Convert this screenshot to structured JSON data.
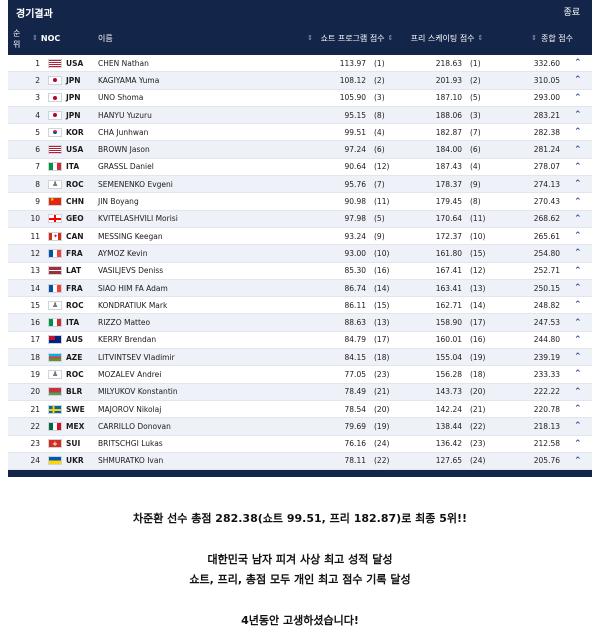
{
  "panel": {
    "title": "경기결과",
    "status": "종료"
  },
  "header": {
    "rank": "순위",
    "noc": "NOC",
    "name": "이름",
    "short": "쇼트 프로그램 점수",
    "free": "프리 스케이팅 점수",
    "total": "종합 점수"
  },
  "rows": [
    {
      "rank": "1",
      "noc": "USA",
      "name": "CHEN Nathan",
      "sp": "113.97",
      "spr": "(1)",
      "fs": "218.63",
      "fsr": "(1)",
      "total": "332.60"
    },
    {
      "rank": "2",
      "noc": "JPN",
      "name": "KAGIYAMA Yuma",
      "sp": "108.12",
      "spr": "(2)",
      "fs": "201.93",
      "fsr": "(2)",
      "total": "310.05"
    },
    {
      "rank": "3",
      "noc": "JPN",
      "name": "UNO Shoma",
      "sp": "105.90",
      "spr": "(3)",
      "fs": "187.10",
      "fsr": "(5)",
      "total": "293.00"
    },
    {
      "rank": "4",
      "noc": "JPN",
      "name": "HANYU Yuzuru",
      "sp": "95.15",
      "spr": "(8)",
      "fs": "188.06",
      "fsr": "(3)",
      "total": "283.21"
    },
    {
      "rank": "5",
      "noc": "KOR",
      "name": "CHA Junhwan",
      "sp": "99.51",
      "spr": "(4)",
      "fs": "182.87",
      "fsr": "(7)",
      "total": "282.38"
    },
    {
      "rank": "6",
      "noc": "USA",
      "name": "BROWN Jason",
      "sp": "97.24",
      "spr": "(6)",
      "fs": "184.00",
      "fsr": "(6)",
      "total": "281.24"
    },
    {
      "rank": "7",
      "noc": "ITA",
      "name": "GRASSL Daniel",
      "sp": "90.64",
      "spr": "(12)",
      "fs": "187.43",
      "fsr": "(4)",
      "total": "278.07"
    },
    {
      "rank": "8",
      "noc": "ROC",
      "name": "SEMENENKO Evgeni",
      "sp": "95.76",
      "spr": "(7)",
      "fs": "178.37",
      "fsr": "(9)",
      "total": "274.13"
    },
    {
      "rank": "9",
      "noc": "CHN",
      "name": "JIN Boyang",
      "sp": "90.98",
      "spr": "(11)",
      "fs": "179.45",
      "fsr": "(8)",
      "total": "270.43"
    },
    {
      "rank": "10",
      "noc": "GEO",
      "name": "KVITELASHVILI Morisi",
      "sp": "97.98",
      "spr": "(5)",
      "fs": "170.64",
      "fsr": "(11)",
      "total": "268.62"
    },
    {
      "rank": "11",
      "noc": "CAN",
      "name": "MESSING Keegan",
      "sp": "93.24",
      "spr": "(9)",
      "fs": "172.37",
      "fsr": "(10)",
      "total": "265.61"
    },
    {
      "rank": "12",
      "noc": "FRA",
      "name": "AYMOZ Kevin",
      "sp": "93.00",
      "spr": "(10)",
      "fs": "161.80",
      "fsr": "(15)",
      "total": "254.80"
    },
    {
      "rank": "13",
      "noc": "LAT",
      "name": "VASILJEVS Deniss",
      "sp": "85.30",
      "spr": "(16)",
      "fs": "167.41",
      "fsr": "(12)",
      "total": "252.71"
    },
    {
      "rank": "14",
      "noc": "FRA",
      "name": "SIAO HIM FA Adam",
      "sp": "86.74",
      "spr": "(14)",
      "fs": "163.41",
      "fsr": "(13)",
      "total": "250.15"
    },
    {
      "rank": "15",
      "noc": "ROC",
      "name": "KONDRATIUK Mark",
      "sp": "86.11",
      "spr": "(15)",
      "fs": "162.71",
      "fsr": "(14)",
      "total": "248.82"
    },
    {
      "rank": "16",
      "noc": "ITA",
      "name": "RIZZO Matteo",
      "sp": "88.63",
      "spr": "(13)",
      "fs": "158.90",
      "fsr": "(17)",
      "total": "247.53"
    },
    {
      "rank": "17",
      "noc": "AUS",
      "name": "KERRY Brendan",
      "sp": "84.79",
      "spr": "(17)",
      "fs": "160.01",
      "fsr": "(16)",
      "total": "244.80"
    },
    {
      "rank": "18",
      "noc": "AZE",
      "name": "LITVINTSEV Vladimir",
      "sp": "84.15",
      "spr": "(18)",
      "fs": "155.04",
      "fsr": "(19)",
      "total": "239.19"
    },
    {
      "rank": "19",
      "noc": "ROC",
      "name": "MOZALEV Andrei",
      "sp": "77.05",
      "spr": "(23)",
      "fs": "156.28",
      "fsr": "(18)",
      "total": "233.33"
    },
    {
      "rank": "20",
      "noc": "BLR",
      "name": "MILYUKOV Konstantin",
      "sp": "78.49",
      "spr": "(21)",
      "fs": "143.73",
      "fsr": "(20)",
      "total": "222.22"
    },
    {
      "rank": "21",
      "noc": "SWE",
      "name": "MAJOROV Nikolaj",
      "sp": "78.54",
      "spr": "(20)",
      "fs": "142.24",
      "fsr": "(21)",
      "total": "220.78"
    },
    {
      "rank": "22",
      "noc": "MEX",
      "name": "CARRILLO Donovan",
      "sp": "79.69",
      "spr": "(19)",
      "fs": "138.44",
      "fsr": "(22)",
      "total": "218.13"
    },
    {
      "rank": "23",
      "noc": "SUI",
      "name": "BRITSCHGI Lukas",
      "sp": "76.16",
      "spr": "(24)",
      "fs": "136.42",
      "fsr": "(23)",
      "total": "212.58"
    },
    {
      "rank": "24",
      "noc": "UKR",
      "name": "SHMURATKO Ivan",
      "sp": "78.11",
      "spr": "(22)",
      "fs": "127.65",
      "fsr": "(24)",
      "total": "205.76"
    }
  ],
  "caption": {
    "line1": "차준환 선수 총점 282.38(쇼트 99.51, 프리 182.87)로 최종 5위!!",
    "line2": "대한민국 남자 피겨 사상 최고 성적 달성",
    "line3": "쇼트, 프리, 총점 모두 개인 최고 점수 기록 달성",
    "line4": "4년동안 고생하셨습니다!"
  },
  "colors": {
    "panel": "#13264a",
    "row_alt": "#eef1f7",
    "chevron": "#2a4f95"
  }
}
